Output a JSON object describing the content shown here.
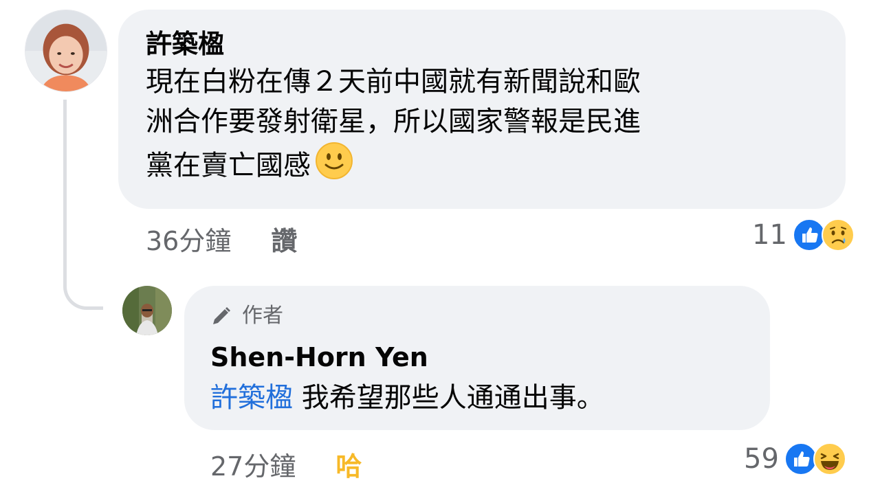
{
  "comment1": {
    "author": "許築楹",
    "text_line1": "現在白粉在傳２天前中國就有新聞說和歐",
    "text_line2": "洲合作要發射衛星，所以國家警報是民進",
    "text_line3": "黨在賣亡國感",
    "emoji": "smile-emoji",
    "time": "36分鐘",
    "action": "讚",
    "reaction_count": "11",
    "reactions": [
      "like-icon",
      "sad-icon"
    ]
  },
  "reply": {
    "badge": "作者",
    "badge_icon": "pencil-icon",
    "author": "Shen-Horn Yen",
    "mention": "許築楹",
    "text": " 我希望那些人通通出事。",
    "time": "27分鐘",
    "action": "哈",
    "action_color": "#f7b928",
    "reaction_count": "59",
    "reactions": [
      "like-icon",
      "haha-icon"
    ]
  },
  "colors": {
    "bubble": "#f0f2f5",
    "mention": "#216fdb",
    "secondary_text": "#65676b",
    "like_blue": "#1877f2"
  }
}
